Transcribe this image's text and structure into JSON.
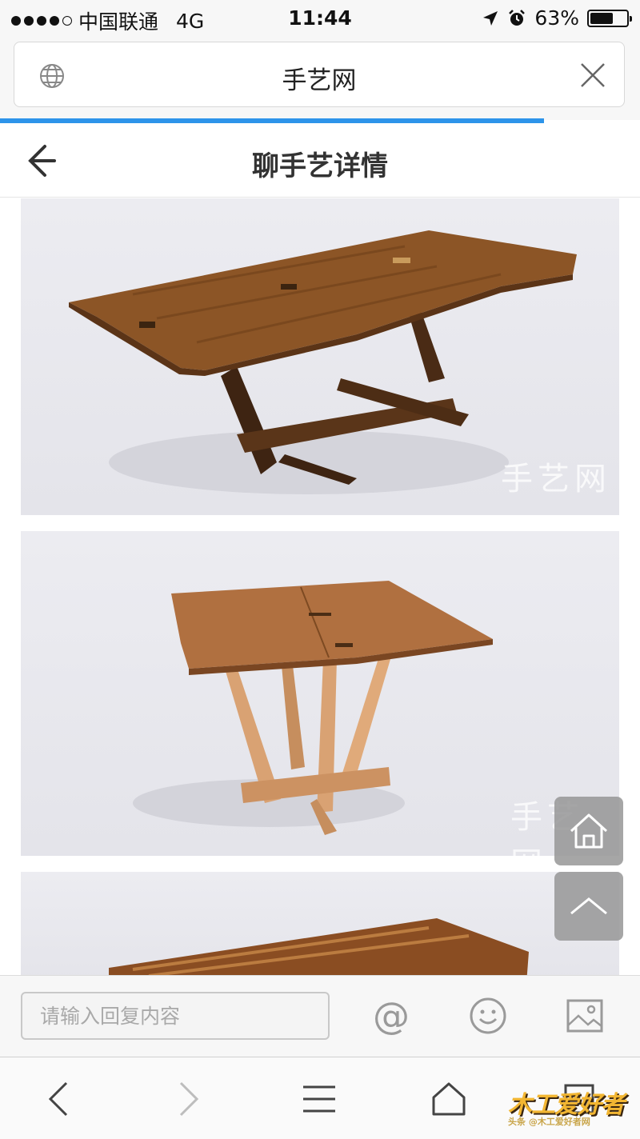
{
  "status": {
    "carrier": "中国联通",
    "network": "4G",
    "time": "11:44",
    "battery": "63%",
    "battery_level": 0.63
  },
  "browser": {
    "address_title": "手艺网",
    "load_progress": 0.85,
    "accent_color": "#2d94ea"
  },
  "header": {
    "title": "聊手艺详情"
  },
  "content": {
    "watermark_1": "手艺网",
    "watermark_2": "手艺网"
  },
  "reply": {
    "placeholder": "请输入回复内容",
    "at_symbol": "@"
  },
  "nav": {
    "tab_count": "1"
  },
  "logo": {
    "main": "木工爱好者",
    "sub": "头条 @木工爱好者网"
  }
}
